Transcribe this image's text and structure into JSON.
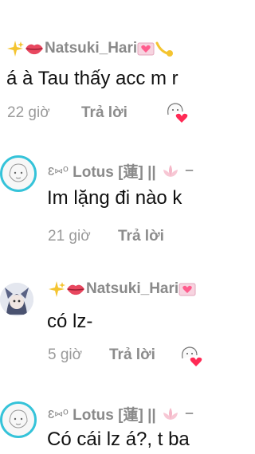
{
  "comments": [
    {
      "username": "Natsuki_Hari",
      "text": "á à Tau thấy acc m r",
      "time": "22 giờ",
      "reply_label": "Trả lời"
    },
    {
      "username": "Lotus [蓮] ||",
      "username_prefix": "ɛ⑅ᵒ",
      "text": "Im lặng đi nào k",
      "time": "21 giờ",
      "reply_label": "Trả lời"
    },
    {
      "username": "Natsuki_Hari",
      "text": "có lz-",
      "time": "5 giờ",
      "reply_label": "Trả lời"
    },
    {
      "username": "Lotus [蓮] ||",
      "username_prefix": "ɛ⑅ᵒ",
      "text": "Có cái lz á?, t ba",
      "time": "",
      "reply_label": ""
    }
  ],
  "colors": {
    "avatar_ring": "#35c3d9",
    "heart": "#ff2a55",
    "text": "#111111",
    "muted": "#9a9a9a"
  },
  "icons": [
    "sparkle-icon",
    "lips-icon",
    "heart-letter-icon",
    "comet-icon",
    "lotus-icon",
    "sticker-heart-icon"
  ]
}
